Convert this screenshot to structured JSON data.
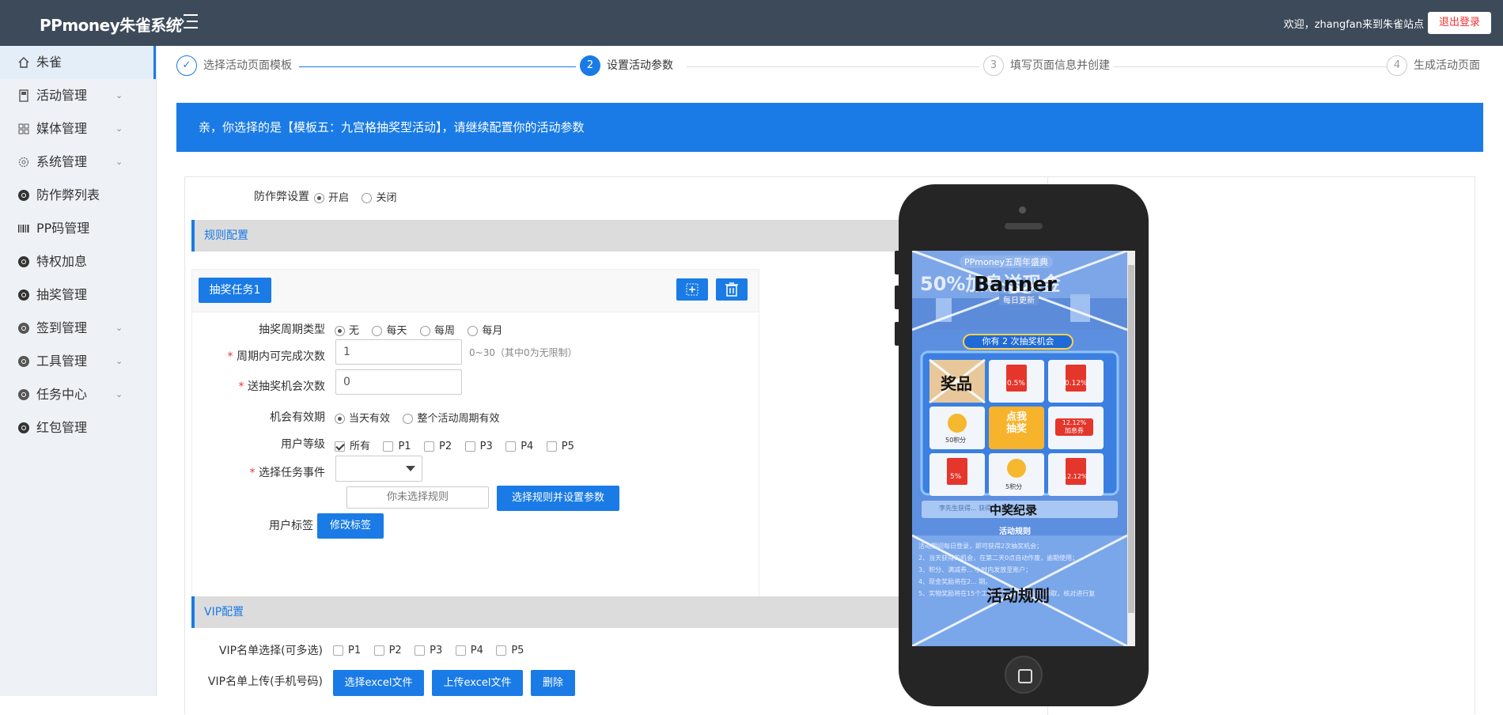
{
  "app": {
    "title": "PPmoney朱雀系统",
    "welcome": "欢迎，zhangfan来到朱雀站点",
    "logout_label": "退出登录"
  },
  "sidebar": {
    "items": [
      {
        "label": "朱雀",
        "icon": "home-icon",
        "chevron": false
      },
      {
        "label": "活动管理",
        "icon": "document-icon",
        "chevron": true
      },
      {
        "label": "媒体管理",
        "icon": "grid-icon",
        "chevron": true
      },
      {
        "label": "系统管理",
        "icon": "gear-icon",
        "chevron": true
      },
      {
        "label": "防作弊列表",
        "icon": "chrome-icon",
        "chevron": false
      },
      {
        "label": "PP码管理",
        "icon": "barcode-icon",
        "chevron": false
      },
      {
        "label": "特权加息",
        "icon": "chrome-icon",
        "chevron": false
      },
      {
        "label": "抽奖管理",
        "icon": "chrome-icon",
        "chevron": false
      },
      {
        "label": "签到管理",
        "icon": "chrome-icon",
        "chevron": true
      },
      {
        "label": "工具管理",
        "icon": "chrome-icon",
        "chevron": true
      },
      {
        "label": "任务中心",
        "icon": "chrome-icon",
        "chevron": true
      },
      {
        "label": "红包管理",
        "icon": "chrome-icon",
        "chevron": false
      }
    ]
  },
  "steps": [
    {
      "num": "✓",
      "label": "选择活动页面模板",
      "state": "done"
    },
    {
      "num": "2",
      "label": "设置活动参数",
      "state": "active"
    },
    {
      "num": "3",
      "label": "填写页面信息并创建",
      "state": "pending"
    },
    {
      "num": "4",
      "label": "生成活动页面",
      "state": "pending"
    }
  ],
  "banner": {
    "text": "亲，你选择的是【模板五：九宫格抽奖型活动】，请继续配置你的活动参数"
  },
  "form": {
    "anticheat_label": "防作弊设置",
    "anticheat_on": "开启",
    "anticheat_off": "关闭",
    "rules_section": "规则配置",
    "task_button": "抽奖任务1",
    "cycle_label": "抽奖周期类型",
    "cycle_options": [
      "无",
      "每天",
      "每周",
      "每月"
    ],
    "times_label": "周期内可完成次数",
    "times_value": "1",
    "times_hint": "0~30（其中0为无限制）",
    "send_label": "送抽奖机会次数",
    "send_value": "0",
    "valid_label": "机会有效期",
    "valid_options": [
      "当天有效",
      "整个活动周期有效"
    ],
    "level_label": "用户等级",
    "level_options": [
      "所有",
      "P1",
      "P2",
      "P3",
      "P4",
      "P5"
    ],
    "event_label": "选择任务事件",
    "rule_placeholder": "你未选择规则",
    "rule_button": "选择规则并设置参数",
    "tag_label": "用户标签",
    "tag_button": "修改标签",
    "vip_section": "VIP配置",
    "vip_select_label": "VIP名单选择(可多选)",
    "vip_options": [
      "P1",
      "P2",
      "P3",
      "P4",
      "P5"
    ],
    "vip_upload_label": "VIP名单上传(手机号码)",
    "vip_choose_button": "选择excel文件",
    "vip_upload_button": "上传excel文件",
    "vip_delete_button": "删除"
  },
  "preview": {
    "top_banner": "PPmoney五周年盛典",
    "promo": "50%加息送现金",
    "daily": "每日更新",
    "banner_label": "Banner",
    "chance": "你有 2 次抽奖机会",
    "prize_label": "奖品",
    "cells": [
      "0.5%",
      "0.12%",
      "50积分",
      "点我\n抽奖",
      "12.12%\n加息券",
      "5%",
      "5积分",
      "12.12%"
    ],
    "records_label": "中奖纪录",
    "records_text": "李先生获得...  获得了100积分",
    "rules_title": "活动规则",
    "rules_label": "活动规则",
    "rules_lines": [
      "活动期间每日登录，即可获得2次抽奖机会；",
      "2、当天获得的机会，在第二天0点自动作废，逾期使用；",
      "3、积分、满减券...           小时内发放至账户；",
      "4、现金奖励将在2...                         期。",
      "5、实物奖励将在15个工作日内，由专人联系领取，核对进行复"
    ]
  }
}
